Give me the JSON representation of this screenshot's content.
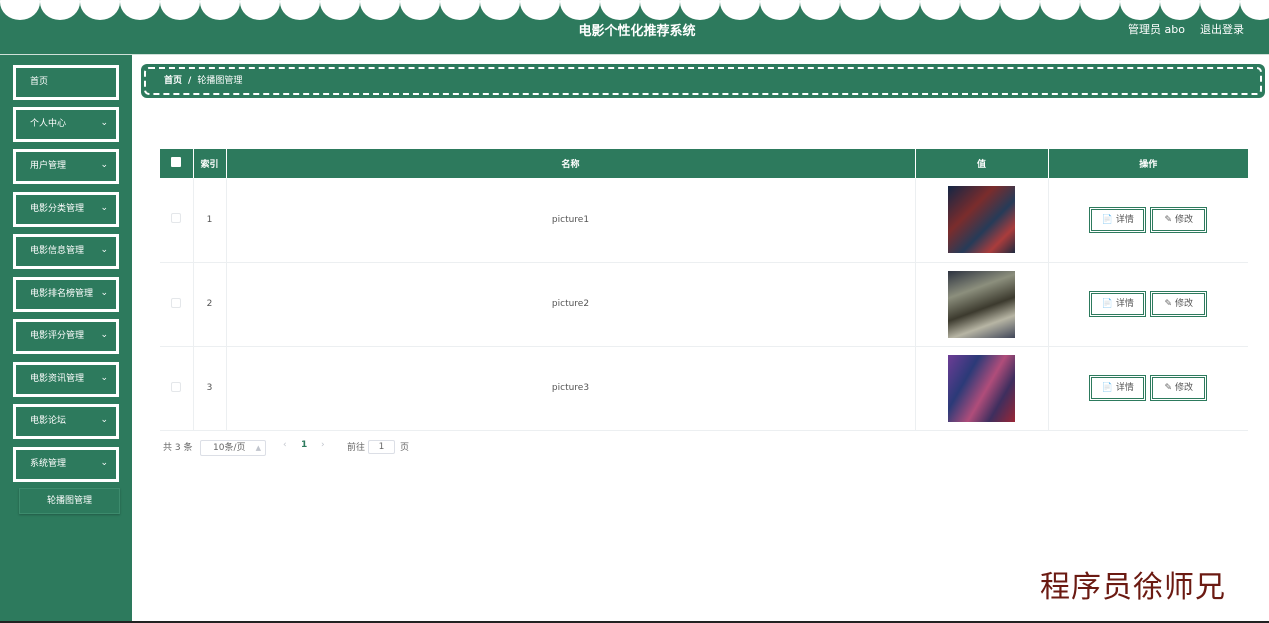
{
  "header": {
    "title": "电影个性化推荐系统",
    "user": "管理员 abo",
    "logout": "退出登录"
  },
  "sidebar": {
    "items": [
      {
        "label": "首页",
        "chevron": ""
      },
      {
        "label": "个人中心",
        "chevron": "⌄"
      },
      {
        "label": "用户管理",
        "chevron": "⌄"
      },
      {
        "label": "电影分类管理",
        "chevron": "⌄"
      },
      {
        "label": "电影信息管理",
        "chevron": "⌄"
      },
      {
        "label": "电影排名榜管理",
        "chevron": "⌄"
      },
      {
        "label": "电影评分管理",
        "chevron": "⌄"
      },
      {
        "label": "电影资讯管理",
        "chevron": "⌄"
      },
      {
        "label": "电影论坛",
        "chevron": "⌄"
      },
      {
        "label": "系统管理",
        "chevron": "⌄"
      }
    ],
    "sub_item": "轮播图管理"
  },
  "breadcrumb": {
    "home": "首页",
    "separator": "/",
    "current": "轮播图管理"
  },
  "table": {
    "columns": {
      "index": "索引",
      "name": "名称",
      "value": "值",
      "actions": "操作"
    },
    "rows": [
      {
        "index": "1",
        "name": "picture1"
      },
      {
        "index": "2",
        "name": "picture2"
      },
      {
        "index": "3",
        "name": "picture3"
      }
    ],
    "detail_label": "详情",
    "edit_label": "修改",
    "detail_icon": "📄",
    "edit_icon": "✎"
  },
  "pagination": {
    "total": "共 3 条",
    "page_size": "10条/页",
    "prev": "‹",
    "current_page": "1",
    "next": "›",
    "goto_label": "前往",
    "goto_value": "1",
    "goto_unit": "页"
  },
  "watermark": "程序员徐师兄",
  "colors": {
    "brand": "#2d7a5d",
    "watermark": "#6b1a12"
  }
}
